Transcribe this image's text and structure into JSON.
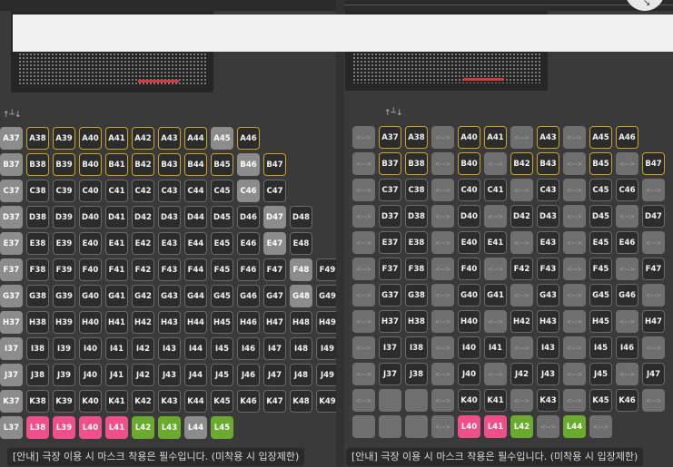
{
  "notice": {
    "left": "[안내] 극장 이용 시 마스크 착용은 필수입니다. (미착용 시 입장제한)",
    "right": "[안내] 극장 이용 시 마스크 착용은 필수입니다. (미착용 시 입장제한)"
  },
  "empty_seat_label": "<-->",
  "left_rows": [
    [
      [
        "A37",
        "gray"
      ],
      [
        "A38",
        "gold"
      ],
      [
        "A39",
        "gold"
      ],
      [
        "A40",
        "gold"
      ],
      [
        "A41",
        "gold"
      ],
      [
        "A42",
        "gold"
      ],
      [
        "A43",
        "gold"
      ],
      [
        "A44",
        "gold"
      ],
      [
        "A45",
        "gray"
      ],
      [
        "A46",
        "gold"
      ]
    ],
    [
      [
        "B37",
        "gray"
      ],
      [
        "B38",
        "gold"
      ],
      [
        "B39",
        "gold"
      ],
      [
        "B40",
        "gold"
      ],
      [
        "B41",
        "gold"
      ],
      [
        "B42",
        "gold"
      ],
      [
        "B43",
        "gold"
      ],
      [
        "B44",
        "gold"
      ],
      [
        "B45",
        "gold"
      ],
      [
        "B46",
        "gray"
      ],
      [
        "B47",
        "gold"
      ]
    ],
    [
      [
        "C37",
        "gray"
      ],
      [
        "C38",
        "dark"
      ],
      [
        "C39",
        "dark"
      ],
      [
        "C40",
        "dark"
      ],
      [
        "C41",
        "dark"
      ],
      [
        "C42",
        "dark"
      ],
      [
        "C43",
        "dark"
      ],
      [
        "C44",
        "dark"
      ],
      [
        "C45",
        "dark"
      ],
      [
        "C46",
        "gray"
      ],
      [
        "C47",
        "dark"
      ]
    ],
    [
      [
        "D37",
        "gray"
      ],
      [
        "D38",
        "dark"
      ],
      [
        "D39",
        "dark"
      ],
      [
        "D40",
        "dark"
      ],
      [
        "D41",
        "dark"
      ],
      [
        "D42",
        "dark"
      ],
      [
        "D43",
        "dark"
      ],
      [
        "D44",
        "dark"
      ],
      [
        "D45",
        "dark"
      ],
      [
        "D46",
        "dark"
      ],
      [
        "D47",
        "gray"
      ],
      [
        "D48",
        "dark"
      ]
    ],
    [
      [
        "E37",
        "gray"
      ],
      [
        "E38",
        "dark"
      ],
      [
        "E39",
        "dark"
      ],
      [
        "E40",
        "dark"
      ],
      [
        "E41",
        "dark"
      ],
      [
        "E42",
        "dark"
      ],
      [
        "E43",
        "dark"
      ],
      [
        "E44",
        "dark"
      ],
      [
        "E45",
        "dark"
      ],
      [
        "E46",
        "dark"
      ],
      [
        "E47",
        "gray"
      ],
      [
        "E48",
        "dark"
      ]
    ],
    [
      [
        "F37",
        "gray"
      ],
      [
        "F38",
        "dark"
      ],
      [
        "F39",
        "dark"
      ],
      [
        "F40",
        "dark"
      ],
      [
        "F41",
        "dark"
      ],
      [
        "F42",
        "dark"
      ],
      [
        "F43",
        "dark"
      ],
      [
        "F44",
        "dark"
      ],
      [
        "F45",
        "dark"
      ],
      [
        "F46",
        "dark"
      ],
      [
        "F47",
        "dark"
      ],
      [
        "F48",
        "gray"
      ],
      [
        "F49",
        "dark"
      ]
    ],
    [
      [
        "G37",
        "gray"
      ],
      [
        "G38",
        "dark"
      ],
      [
        "G39",
        "dark"
      ],
      [
        "G40",
        "dark"
      ],
      [
        "G41",
        "dark"
      ],
      [
        "G42",
        "dark"
      ],
      [
        "G43",
        "dark"
      ],
      [
        "G44",
        "dark"
      ],
      [
        "G45",
        "dark"
      ],
      [
        "G46",
        "dark"
      ],
      [
        "G47",
        "dark"
      ],
      [
        "G48",
        "gray"
      ],
      [
        "G49",
        "dark"
      ]
    ],
    [
      [
        "H37",
        "gray"
      ],
      [
        "H38",
        "dark"
      ],
      [
        "H39",
        "dark"
      ],
      [
        "H40",
        "dark"
      ],
      [
        "H41",
        "dark"
      ],
      [
        "H42",
        "dark"
      ],
      [
        "H43",
        "dark"
      ],
      [
        "H44",
        "dark"
      ],
      [
        "H45",
        "dark"
      ],
      [
        "H46",
        "dark"
      ],
      [
        "H47",
        "dark"
      ],
      [
        "H48",
        "dark"
      ],
      [
        "H49",
        "dark"
      ]
    ],
    [
      [
        "I37",
        "gray"
      ],
      [
        "I38",
        "dark"
      ],
      [
        "I39",
        "dark"
      ],
      [
        "I40",
        "dark"
      ],
      [
        "I41",
        "dark"
      ],
      [
        "I42",
        "dark"
      ],
      [
        "I43",
        "dark"
      ],
      [
        "I44",
        "dark"
      ],
      [
        "I45",
        "dark"
      ],
      [
        "I46",
        "dark"
      ],
      [
        "I47",
        "dark"
      ],
      [
        "I48",
        "dark"
      ],
      [
        "I49",
        "dark"
      ]
    ],
    [
      [
        "J37",
        "gray"
      ],
      [
        "J38",
        "dark"
      ],
      [
        "J39",
        "dark"
      ],
      [
        "J40",
        "dark"
      ],
      [
        "J41",
        "dark"
      ],
      [
        "J42",
        "dark"
      ],
      [
        "J43",
        "dark"
      ],
      [
        "J44",
        "dark"
      ],
      [
        "J45",
        "dark"
      ],
      [
        "J46",
        "dark"
      ],
      [
        "J47",
        "dark"
      ],
      [
        "J48",
        "dark"
      ],
      [
        "J49",
        "dark"
      ]
    ],
    [
      [
        "K37",
        "gray"
      ],
      [
        "K38",
        "dark"
      ],
      [
        "K39",
        "dark"
      ],
      [
        "K40",
        "dark"
      ],
      [
        "K41",
        "dark"
      ],
      [
        "K42",
        "dark"
      ],
      [
        "K43",
        "dark"
      ],
      [
        "K44",
        "dark"
      ],
      [
        "K45",
        "dark"
      ],
      [
        "K46",
        "dark"
      ],
      [
        "K47",
        "dark"
      ],
      [
        "K48",
        "dark"
      ],
      [
        "K49",
        "dark"
      ]
    ],
    [
      [
        "L37",
        "gray"
      ],
      [
        "L38",
        "pink"
      ],
      [
        "L39",
        "pink"
      ],
      [
        "L40",
        "pink"
      ],
      [
        "L41",
        "pink"
      ],
      [
        "L42",
        "green"
      ],
      [
        "L43",
        "green"
      ],
      [
        "L44",
        "gray"
      ],
      [
        "L45",
        "green"
      ]
    ]
  ],
  "right_rows": [
    [
      [
        "",
        "empty"
      ],
      [
        "A37",
        "gold"
      ],
      [
        "A38",
        "gold"
      ],
      [
        "",
        "empty"
      ],
      [
        "A40",
        "gold"
      ],
      [
        "A41",
        "gold"
      ],
      [
        "",
        "empty"
      ],
      [
        "A43",
        "gold"
      ],
      [
        "",
        "empty"
      ],
      [
        "A45",
        "gold"
      ],
      [
        "A46",
        "gold"
      ]
    ],
    [
      [
        "",
        "empty"
      ],
      [
        "B37",
        "gold"
      ],
      [
        "B38",
        "gold"
      ],
      [
        "",
        "empty"
      ],
      [
        "B40",
        "gold"
      ],
      [
        "",
        "empty"
      ],
      [
        "B42",
        "gold"
      ],
      [
        "B43",
        "gold"
      ],
      [
        "",
        "empty"
      ],
      [
        "B45",
        "gold"
      ],
      [
        "",
        "empty"
      ],
      [
        "B47",
        "gold"
      ]
    ],
    [
      [
        "",
        "empty"
      ],
      [
        "C37",
        "dark"
      ],
      [
        "C38",
        "dark"
      ],
      [
        "",
        "empty"
      ],
      [
        "C40",
        "dark"
      ],
      [
        "C41",
        "dark"
      ],
      [
        "",
        "empty"
      ],
      [
        "C43",
        "dark"
      ],
      [
        "",
        "empty"
      ],
      [
        "C45",
        "dark"
      ],
      [
        "C46",
        "dark"
      ],
      [
        "",
        "empty"
      ]
    ],
    [
      [
        "",
        "empty"
      ],
      [
        "D37",
        "dark"
      ],
      [
        "D38",
        "dark"
      ],
      [
        "",
        "empty"
      ],
      [
        "D40",
        "dark"
      ],
      [
        "",
        "empty"
      ],
      [
        "D42",
        "dark"
      ],
      [
        "D43",
        "dark"
      ],
      [
        "",
        "empty"
      ],
      [
        "D45",
        "dark"
      ],
      [
        "",
        "empty"
      ],
      [
        "D47",
        "dark"
      ]
    ],
    [
      [
        "",
        "empty"
      ],
      [
        "E37",
        "dark"
      ],
      [
        "E38",
        "dark"
      ],
      [
        "",
        "empty"
      ],
      [
        "E40",
        "dark"
      ],
      [
        "E41",
        "dark"
      ],
      [
        "",
        "empty"
      ],
      [
        "E43",
        "dark"
      ],
      [
        "",
        "empty"
      ],
      [
        "E45",
        "dark"
      ],
      [
        "E46",
        "dark"
      ],
      [
        "",
        "empty"
      ]
    ],
    [
      [
        "",
        "empty"
      ],
      [
        "F37",
        "dark"
      ],
      [
        "F38",
        "dark"
      ],
      [
        "",
        "empty"
      ],
      [
        "F40",
        "dark"
      ],
      [
        "",
        "empty"
      ],
      [
        "F42",
        "dark"
      ],
      [
        "F43",
        "dark"
      ],
      [
        "",
        "empty"
      ],
      [
        "F45",
        "dark"
      ],
      [
        "",
        "empty"
      ],
      [
        "F47",
        "dark"
      ]
    ],
    [
      [
        "",
        "empty"
      ],
      [
        "G37",
        "dark"
      ],
      [
        "G38",
        "dark"
      ],
      [
        "",
        "empty"
      ],
      [
        "G40",
        "dark"
      ],
      [
        "G41",
        "dark"
      ],
      [
        "",
        "empty"
      ],
      [
        "G43",
        "dark"
      ],
      [
        "",
        "empty"
      ],
      [
        "G45",
        "dark"
      ],
      [
        "G46",
        "dark"
      ],
      [
        "",
        "empty"
      ]
    ],
    [
      [
        "",
        "empty"
      ],
      [
        "H37",
        "dark"
      ],
      [
        "H38",
        "dark"
      ],
      [
        "",
        "empty"
      ],
      [
        "H40",
        "dark"
      ],
      [
        "",
        "empty"
      ],
      [
        "H42",
        "dark"
      ],
      [
        "H43",
        "dark"
      ],
      [
        "",
        "empty"
      ],
      [
        "H45",
        "dark"
      ],
      [
        "",
        "empty"
      ],
      [
        "H47",
        "dark"
      ]
    ],
    [
      [
        "",
        "empty"
      ],
      [
        "I37",
        "dark"
      ],
      [
        "I38",
        "dark"
      ],
      [
        "",
        "empty"
      ],
      [
        "I40",
        "dark"
      ],
      [
        "I41",
        "dark"
      ],
      [
        "",
        "empty"
      ],
      [
        "I43",
        "dark"
      ],
      [
        "",
        "empty"
      ],
      [
        "I45",
        "dark"
      ],
      [
        "I46",
        "dark"
      ],
      [
        "",
        "empty"
      ]
    ],
    [
      [
        "",
        "empty"
      ],
      [
        "J37",
        "dark"
      ],
      [
        "J38",
        "dark"
      ],
      [
        "",
        "empty"
      ],
      [
        "J40",
        "dark"
      ],
      [
        "",
        "empty"
      ],
      [
        "J42",
        "dark"
      ],
      [
        "J43",
        "dark"
      ],
      [
        "",
        "empty"
      ],
      [
        "J45",
        "dark"
      ],
      [
        "",
        "empty"
      ],
      [
        "J47",
        "dark"
      ]
    ],
    [
      [
        "",
        "empty"
      ],
      [
        "",
        "plain"
      ],
      [
        "",
        "plain"
      ],
      [
        "",
        "empty"
      ],
      [
        "K40",
        "dark"
      ],
      [
        "K41",
        "dark"
      ],
      [
        "",
        "empty"
      ],
      [
        "K43",
        "dark"
      ],
      [
        "",
        "empty"
      ],
      [
        "K45",
        "dark"
      ],
      [
        "K46",
        "dark"
      ],
      [
        "",
        "empty"
      ]
    ],
    [
      [
        "",
        "plain"
      ],
      [
        "",
        "plain"
      ],
      [
        "",
        "plain"
      ],
      [
        "",
        "empty"
      ],
      [
        "L40",
        "pink"
      ],
      [
        "L41",
        "pink"
      ],
      [
        "L42",
        "green"
      ],
      [
        "",
        "empty"
      ],
      [
        "L44",
        "green"
      ],
      [
        "",
        "empty"
      ]
    ]
  ]
}
